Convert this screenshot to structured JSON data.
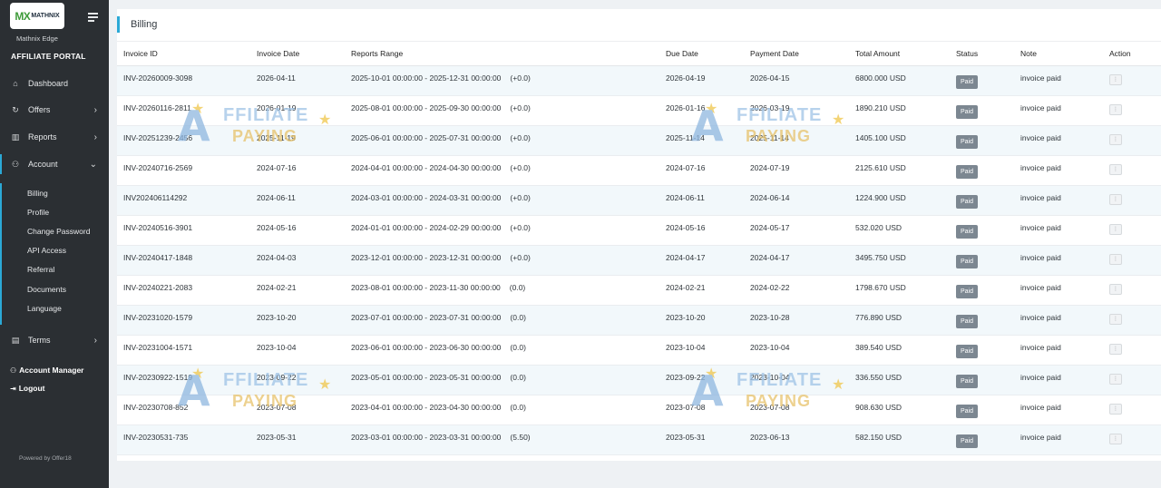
{
  "sidebar": {
    "logo": {
      "mark": "MX",
      "word": "MATHNIX"
    },
    "brand_name": "Mathnix Edge",
    "portal_title": "AFFILIATE PORTAL",
    "nav": [
      {
        "label": "Dashboard",
        "icon": "home-icon"
      },
      {
        "label": "Offers",
        "icon": "refresh-icon"
      },
      {
        "label": "Reports",
        "icon": "chart-icon"
      },
      {
        "label": "Account",
        "icon": "user-gear-icon"
      }
    ],
    "account_sub": [
      "Billing",
      "Profile",
      "Change Password",
      "API Access",
      "Referral",
      "Documents",
      "Language"
    ],
    "terms": "Terms",
    "account_manager": "Account Manager",
    "logout": "Logout",
    "powered": "Powered by Offer18"
  },
  "page": {
    "title": "Billing"
  },
  "table": {
    "headers": [
      "Invoice ID",
      "Invoice Date",
      "Reports Range",
      "Due Date",
      "Payment Date",
      "Total Amount",
      "Status",
      "Note",
      "Action"
    ],
    "rows": [
      {
        "id": "INV-20260009-3098",
        "date": "2026-04-11",
        "range": "2025-10-01 00:00:00 - 2025-12-31 00:00:00",
        "delta": "(+0.0)",
        "due": "2026-04-19",
        "paid_on": "2026-04-15",
        "amount": "6800.000 USD",
        "status": "Paid",
        "note": "invoice paid"
      },
      {
        "id": "INV-20260116-2811",
        "date": "2026-01-19",
        "range": "2025-08-01 00:00:00 - 2025-09-30 00:00:00",
        "delta": "(+0.0)",
        "due": "2026-01-16",
        "paid_on": "2026-03-19",
        "amount": "1890.210 USD",
        "status": "Paid",
        "note": "invoice paid"
      },
      {
        "id": "INV-20251239-2456",
        "date": "2025-11-19",
        "range": "2025-06-01 00:00:00 - 2025-07-31 00:00:00",
        "delta": "(+0.0)",
        "due": "2025-11-14",
        "paid_on": "2025-11-14",
        "amount": "1405.100 USD",
        "status": "Paid",
        "note": "invoice paid"
      },
      {
        "id": "INV-20240716-2569",
        "date": "2024-07-16",
        "range": "2024-04-01 00:00:00 - 2024-04-30 00:00:00",
        "delta": "(+0.0)",
        "due": "2024-07-16",
        "paid_on": "2024-07-19",
        "amount": "2125.610 USD",
        "status": "Paid",
        "note": "invoice paid"
      },
      {
        "id": "INV202406114292",
        "date": "2024-06-11",
        "range": "2024-03-01 00:00:00 - 2024-03-31 00:00:00",
        "delta": "(+0.0)",
        "due": "2024-06-11",
        "paid_on": "2024-06-14",
        "amount": "1224.900 USD",
        "status": "Paid",
        "note": "invoice paid"
      },
      {
        "id": "INV-20240516-3901",
        "date": "2024-05-16",
        "range": "2024-01-01 00:00:00 - 2024-02-29 00:00:00",
        "delta": "(+0.0)",
        "due": "2024-05-16",
        "paid_on": "2024-05-17",
        "amount": "532.020 USD",
        "status": "Paid",
        "note": "invoice paid"
      },
      {
        "id": "INV-20240417-1848",
        "date": "2024-04-03",
        "range": "2023-12-01 00:00:00 - 2023-12-31 00:00:00",
        "delta": "(+0.0)",
        "due": "2024-04-17",
        "paid_on": "2024-04-17",
        "amount": "3495.750 USD",
        "status": "Paid",
        "note": "invoice paid"
      },
      {
        "id": "INV-20240221-2083",
        "date": "2024-02-21",
        "range": "2023-08-01 00:00:00 - 2023-11-30 00:00:00",
        "delta": "(0.0)",
        "due": "2024-02-21",
        "paid_on": "2024-02-22",
        "amount": "1798.670 USD",
        "status": "Paid",
        "note": "invoice paid"
      },
      {
        "id": "INV-20231020-1579",
        "date": "2023-10-20",
        "range": "2023-07-01 00:00:00 - 2023-07-31 00:00:00",
        "delta": "(0.0)",
        "due": "2023-10-20",
        "paid_on": "2023-10-28",
        "amount": "776.890 USD",
        "status": "Paid",
        "note": "invoice paid"
      },
      {
        "id": "INV-20231004-1571",
        "date": "2023-10-04",
        "range": "2023-06-01 00:00:00 - 2023-06-30 00:00:00",
        "delta": "(0.0)",
        "due": "2023-10-04",
        "paid_on": "2023-10-04",
        "amount": "389.540 USD",
        "status": "Paid",
        "note": "invoice paid"
      },
      {
        "id": "INV-20230922-1519",
        "date": "2023-09-22",
        "range": "2023-05-01 00:00:00 - 2023-05-31 00:00:00",
        "delta": "(0.0)",
        "due": "2023-09-22",
        "paid_on": "2023-10-04",
        "amount": "336.550 USD",
        "status": "Paid",
        "note": "invoice paid"
      },
      {
        "id": "INV-20230708-852",
        "date": "2023-07-08",
        "range": "2023-04-01 00:00:00 - 2023-04-30 00:00:00",
        "delta": "(0.0)",
        "due": "2023-07-08",
        "paid_on": "2023-07-08",
        "amount": "908.630 USD",
        "status": "Paid",
        "note": "invoice paid"
      },
      {
        "id": "INV-20230531-735",
        "date": "2023-05-31",
        "range": "2023-03-01 00:00:00 - 2023-03-31 00:00:00",
        "delta": "(5.50)",
        "due": "2023-05-31",
        "paid_on": "2023-06-13",
        "amount": "582.150 USD",
        "status": "Paid",
        "note": "invoice paid"
      }
    ]
  },
  "watermark": {
    "letter": "A",
    "line1": "FFILIATE",
    "line2": "PAYING"
  },
  "colors": {
    "sidebar_bg": "#2b2f33",
    "accent": "#2ba9d6",
    "badge_bg": "#7c8791",
    "row_stripe": "#f2f8fb"
  }
}
